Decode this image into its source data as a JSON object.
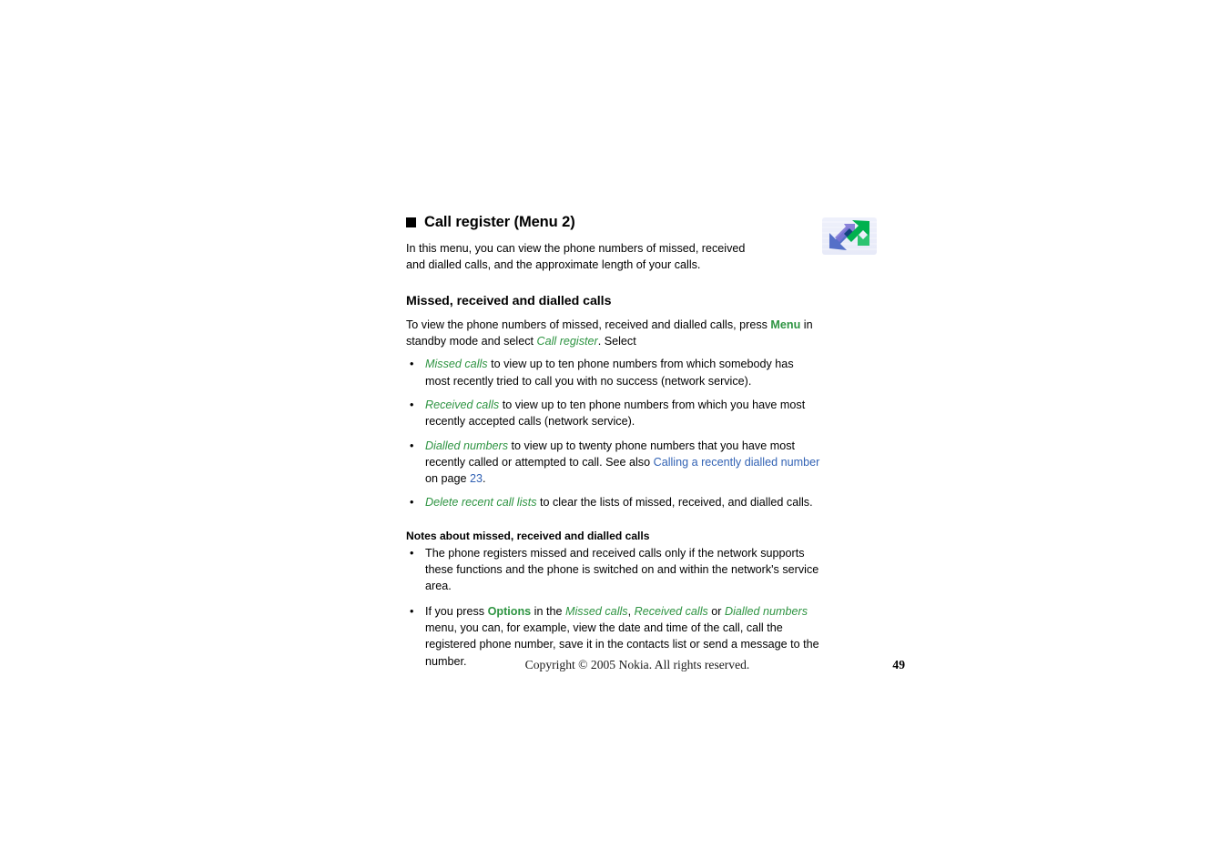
{
  "chapter": {
    "heading": "Call register (Menu 2)",
    "bullet_icon": "black-square-bullet",
    "icon_name": "call-register-arrows-icon",
    "intro": "In this menu, you can view the phone numbers of missed, received and dialled calls, and the approximate length of your calls."
  },
  "section": {
    "heading": "Missed, received and dialled calls",
    "intro_part1": "To view the phone numbers of missed, received and dialled calls, press ",
    "intro_menu": "Menu",
    "intro_part2": " in standby mode and select ",
    "intro_callregister": "Call register",
    "intro_part3": ". Select",
    "bullets": [
      {
        "term": "Missed calls",
        "text": " to view up to ten phone numbers from which somebody has most recently tried to call you with no success (network service)."
      },
      {
        "term": "Received calls",
        "text": " to view up to ten phone numbers from which you have most recently accepted calls (network service)."
      },
      {
        "term": "Dialled numbers",
        "text_before_link": " to view up to twenty phone numbers that you have most recently called or attempted to call. See also ",
        "link": "Calling a recently dialled number",
        "text_after_link": " on page ",
        "page_ref": "23",
        "text_end": "."
      },
      {
        "term": "Delete recent call lists",
        "text": " to clear the lists of missed, received, and dialled calls."
      }
    ]
  },
  "notes": {
    "heading": "Notes about missed, received and dialled calls",
    "items": [
      {
        "text": "The phone registers missed and received calls only if the network supports these functions and the phone is switched on and within the network's service area."
      },
      {
        "text_part1": "If you press ",
        "options": "Options",
        "text_part2": " in the ",
        "menu1": "Missed calls",
        "sep1": ", ",
        "menu2": "Received calls",
        "sep2": " or ",
        "menu3": "Dialled numbers",
        "text_part3": " menu, you can, for example, view the date and time of the call, call the registered phone number, save it in the contacts list or send a message to the number."
      }
    ]
  },
  "footer": {
    "copyright": "Copyright © 2005 Nokia. All rights reserved.",
    "page_number": "49"
  },
  "colors": {
    "emphasis_green": "#2e9442",
    "link_blue": "#3262b4",
    "icon_green": "#00b14f",
    "icon_blue": "#5b6fd0",
    "icon_purple": "#7b6fd6",
    "icon_teal": "#1b4f8a"
  }
}
